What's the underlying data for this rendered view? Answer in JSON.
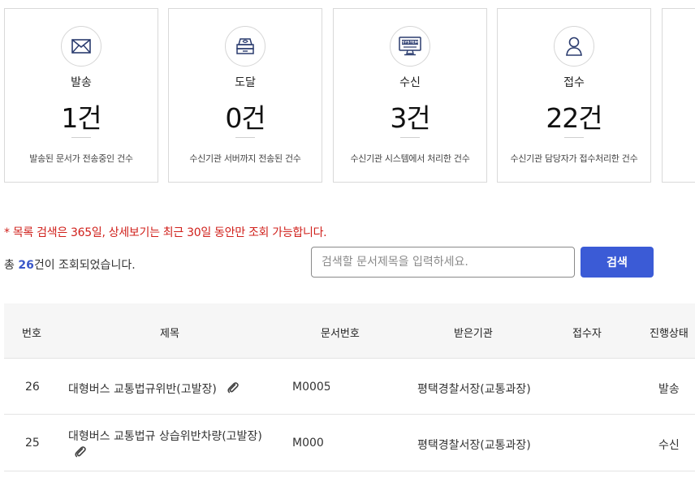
{
  "cards": [
    {
      "icon": "envelope-icon",
      "label": "발송",
      "count": "1건",
      "desc": "발송된 문서가 전송중인 건수"
    },
    {
      "icon": "inbox-tray-icon",
      "label": "도달",
      "count": "0건",
      "desc": "수신기관 서버까지 전송된 건수"
    },
    {
      "icon": "system-monitor-icon",
      "label": "수신",
      "count": "3건",
      "desc": "수신기관 시스템에서 처리한 건수"
    },
    {
      "icon": "person-icon",
      "label": "접수",
      "count": "22건",
      "desc": "수신기관 담당자가 접수처리한 건수"
    }
  ],
  "notice": "* 목록 검색은 365일, 상세보기는 최근 30일 동안만 조회 가능합니다.",
  "total": {
    "prefix": "총 ",
    "count": "26",
    "suffix": "건이 조회되었습니다."
  },
  "search": {
    "placeholder": "검색할 문서제목을 입력하세요.",
    "value": "",
    "button_label": "검색"
  },
  "table": {
    "headers": [
      "번호",
      "제목",
      "문서번호",
      "받은기관",
      "접수자",
      "진행상태"
    ],
    "rows": [
      {
        "no": "26",
        "title_line1": "대형버스 교통법규위반(고발장)",
        "title_line2": "",
        "doc_no": "M0005",
        "org": "평택경찰서장(교통과장)",
        "receiver": "",
        "status": "발송",
        "attachment_icon": "paperclip-icon"
      },
      {
        "no": "25",
        "title_line1": "대형버스 교통법규 상습위반차량(고발장)",
        "title_line2": "",
        "doc_no": "M000",
        "org": "평택경찰서장(교통과장)",
        "receiver": "",
        "status": "수신",
        "attachment_icon": "paperclip-icon"
      }
    ]
  },
  "icon_svg_text": {
    "system": "SYSTEM"
  }
}
